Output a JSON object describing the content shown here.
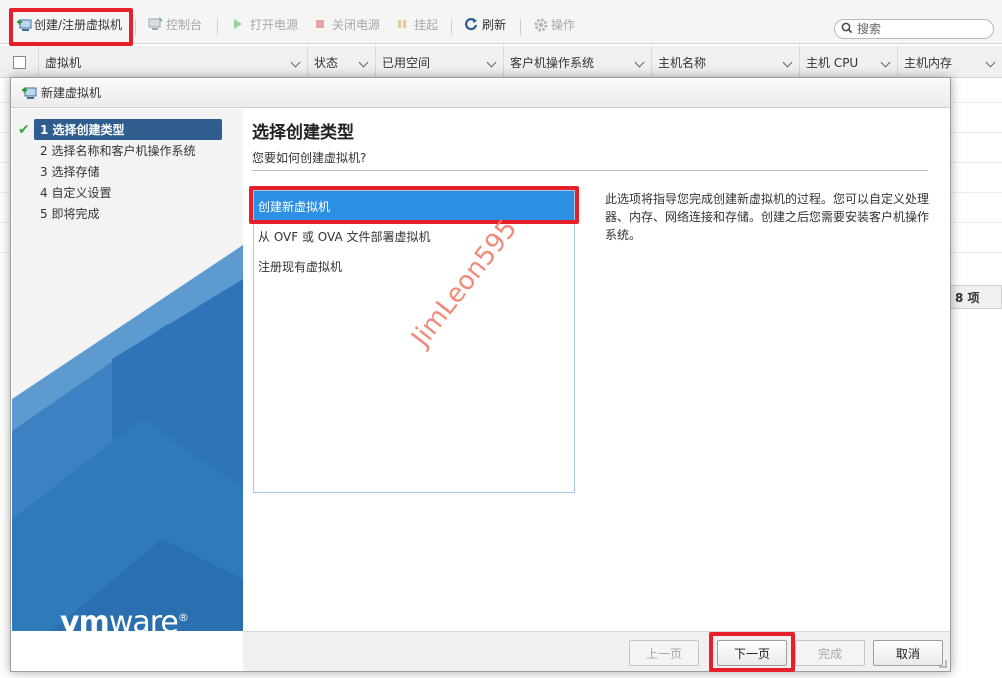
{
  "toolbar": {
    "create_register_vm": "创建/注册虚拟机",
    "console": "控制台",
    "power_on": "打开电源",
    "power_off": "关闭电源",
    "suspend": "挂起",
    "refresh": "刷新",
    "actions": "操作",
    "search_placeholder": "搜索"
  },
  "grid": {
    "columns": [
      "虚拟机",
      "状态",
      "已用空间",
      "客户机操作系统",
      "主机名称",
      "主机 CPU",
      "主机内存"
    ],
    "count_label": "8 项"
  },
  "dialog": {
    "title": "新建虚拟机",
    "steps": [
      {
        "label": "1 选择创建类型",
        "active": true,
        "done": true
      },
      {
        "label": "2 选择名称和客户机操作系统",
        "active": false,
        "done": false
      },
      {
        "label": "3 选择存储",
        "active": false,
        "done": false
      },
      {
        "label": "4 自定义设置",
        "active": false,
        "done": false
      },
      {
        "label": "5 即将完成",
        "active": false,
        "done": false
      }
    ],
    "heading": "选择创建类型",
    "subheading": "您要如何创建虚拟机?",
    "options": [
      {
        "label": "创建新虚拟机",
        "selected": true
      },
      {
        "label": "从 OVF 或 OVA 文件部署虚拟机",
        "selected": false
      },
      {
        "label": "注册现有虚拟机",
        "selected": false
      }
    ],
    "description": "此选项将指导您完成创建新虚拟机的过程。您可以自定义处理器、内存、网络连接和存储。创建之后您需要安装客户机操作系统。",
    "logo_vm": "vm",
    "logo_ware": "ware",
    "logo_reg": "®",
    "watermark": "JimLeon595",
    "buttons": {
      "prev": "上一页",
      "next": "下一页",
      "finish": "完成",
      "cancel": "取消"
    }
  },
  "colors": {
    "accent_selected": "#2b8fe3",
    "step_active": "#2f5d8d",
    "highlight_red": "#e5202a",
    "panel_blue": "#2e7fc2"
  }
}
